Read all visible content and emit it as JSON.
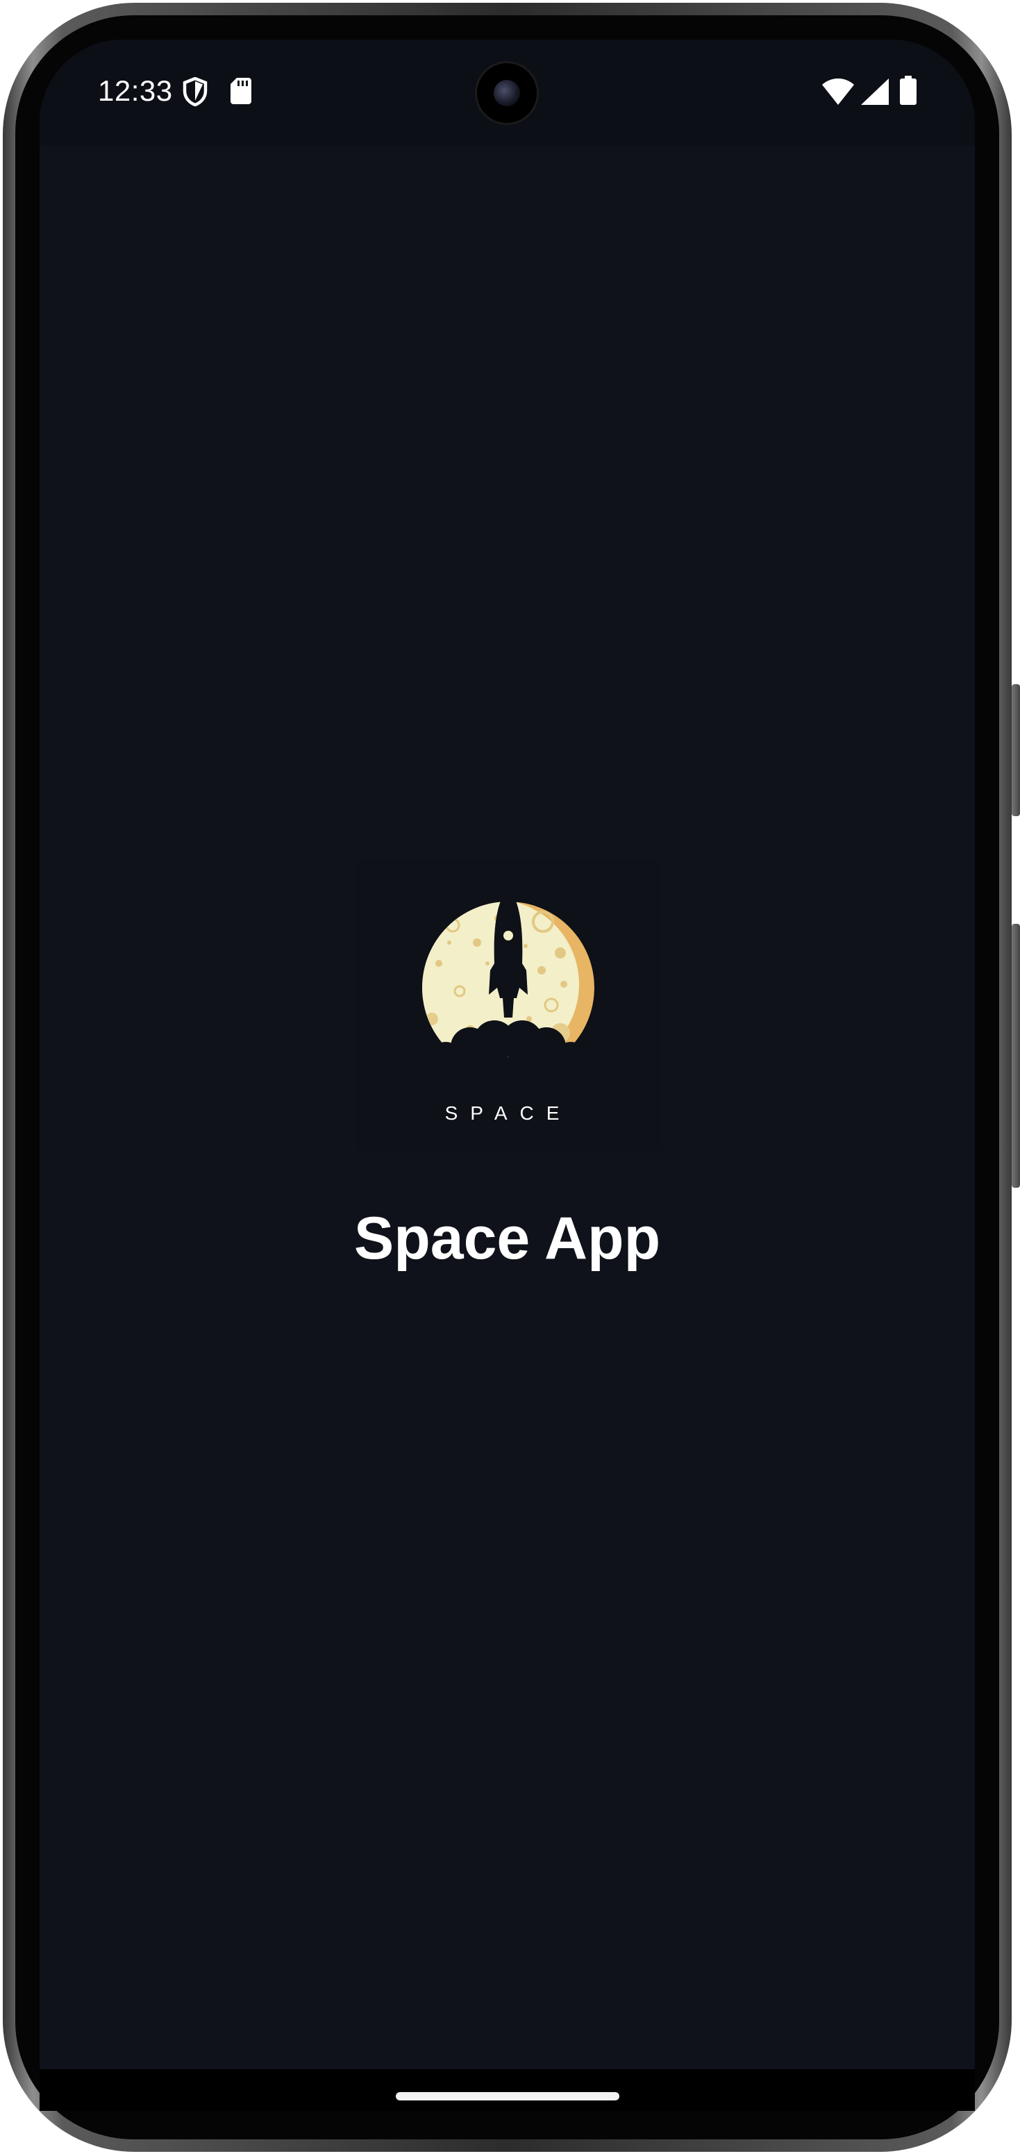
{
  "status_bar": {
    "time": "12:33",
    "left_icons": [
      "shield-icon",
      "sd-card-icon"
    ],
    "right_icons": [
      "wifi-icon",
      "cell-signal-icon",
      "battery-icon"
    ]
  },
  "splash": {
    "logo_text": "SPACE",
    "app_title": "Space App"
  },
  "colors": {
    "background": "#0f121a",
    "status_bar_bg": "#0c0f15",
    "moon_light": "#f3efc8",
    "moon_shadow": "#e7b563",
    "text": "#ffffff"
  }
}
